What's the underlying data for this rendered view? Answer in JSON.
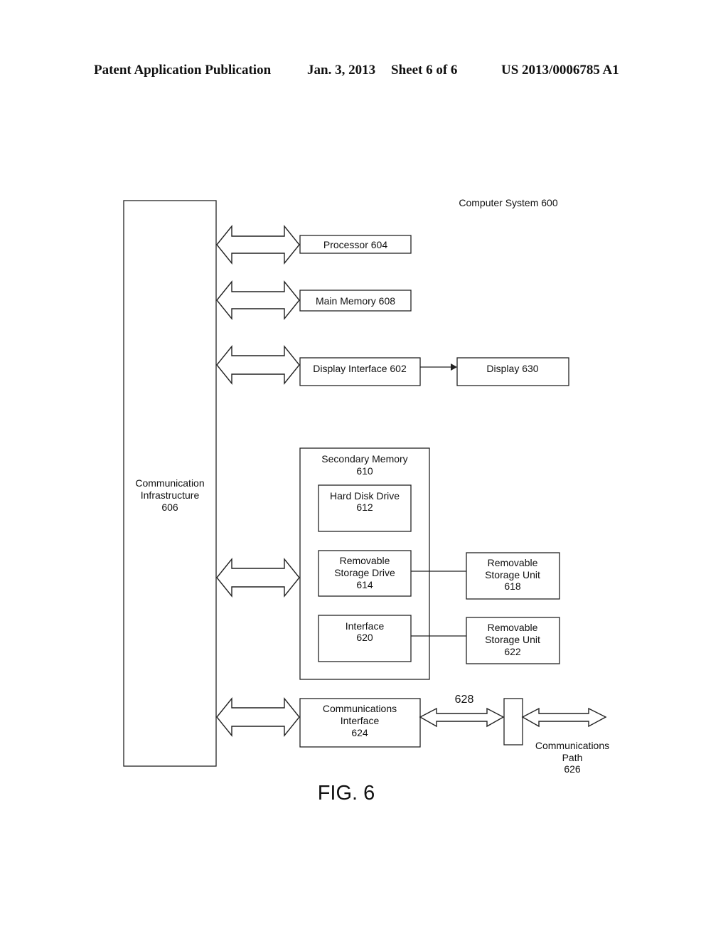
{
  "header": {
    "publication": "Patent Application Publication",
    "date": "Jan. 3, 2013",
    "sheet": "Sheet 6 of 6",
    "patent_number": "US 2013/0006785 A1"
  },
  "diagram": {
    "system_title": "Computer System 600",
    "figure_label": "FIG. 6",
    "comm_infrastructure": [
      "Communication",
      "Infrastructure",
      "606"
    ],
    "processor": "Processor 604",
    "main_memory": "Main Memory 608",
    "display_interface": "Display Interface 602",
    "display": "Display 630",
    "secondary_memory": [
      "Secondary Memory",
      "610"
    ],
    "hard_disk_drive": [
      "Hard Disk Drive",
      "612"
    ],
    "removable_storage_drive": [
      "Removable",
      "Storage Drive",
      "614"
    ],
    "interface": [
      "Interface",
      "620"
    ],
    "removable_storage_unit_618": [
      "Removable",
      "Storage Unit",
      "618"
    ],
    "removable_storage_unit_622": [
      "Removable",
      "Storage Unit",
      "622"
    ],
    "communications_interface": [
      "Communications",
      "Interface",
      "624"
    ],
    "signal_label": "628",
    "communications_path": [
      "Communications",
      "Path",
      "626"
    ]
  }
}
